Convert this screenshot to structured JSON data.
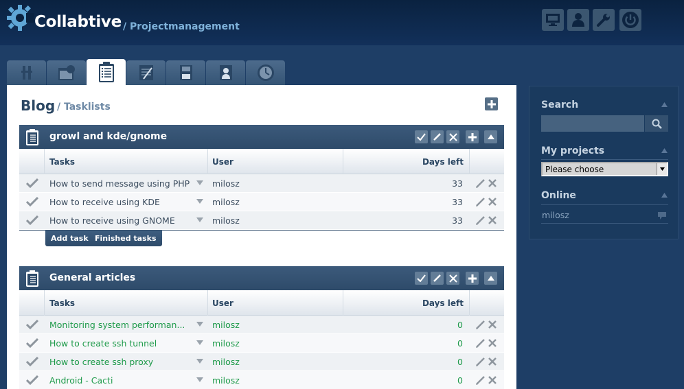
{
  "header": {
    "app_name": "Collabtive",
    "subtitle": "/ Projectmanagement",
    "buttons": [
      {
        "icon": "desktop-icon"
      },
      {
        "icon": "user-icon"
      },
      {
        "icon": "wrench-icon"
      },
      {
        "icon": "power-icon"
      }
    ]
  },
  "tabs": [
    {
      "icon": "tools-icon",
      "active": false
    },
    {
      "icon": "calendar-icon",
      "active": false
    },
    {
      "icon": "clipboard-icon",
      "active": true
    },
    {
      "icon": "notepad-icon",
      "active": false
    },
    {
      "icon": "save-icon",
      "active": false
    },
    {
      "icon": "badge-icon",
      "active": false
    },
    {
      "icon": "clock-icon",
      "active": false
    }
  ],
  "page": {
    "title": "Blog",
    "crumb": "/ Tasklists"
  },
  "columns": {
    "tasks": "Tasks",
    "user": "User",
    "days": "Days left"
  },
  "tasklists": [
    {
      "title": "growl and kde/gnome",
      "rows": [
        {
          "task": "How to send message using PHP",
          "user": "milosz",
          "days": "33"
        },
        {
          "task": "How to receive using KDE",
          "user": "milosz",
          "days": "33"
        },
        {
          "task": "How to receive using GNOME",
          "user": "milosz",
          "days": "33"
        }
      ],
      "buttons": {
        "add": "Add task",
        "finished": "Finished tasks"
      }
    },
    {
      "title": "General articles",
      "rows": [
        {
          "task": "Monitoring system performan...",
          "user": "milosz",
          "days": "0"
        },
        {
          "task": "How to create ssh tunnel",
          "user": "milosz",
          "days": "0"
        },
        {
          "task": "How to create ssh proxy",
          "user": "milosz",
          "days": "0"
        },
        {
          "task": "Android - Cacti",
          "user": "milosz",
          "days": "0"
        }
      ]
    }
  ],
  "sidebar": {
    "search_label": "Search",
    "projects_label": "My projects",
    "projects_selected": "Please choose",
    "online_label": "Online",
    "online_users": [
      "milosz"
    ]
  },
  "colors": {
    "header_bg": "#0a2240",
    "body_bg": "#1e3e66",
    "accent_green": "#1e9a4a",
    "title_blue": "#2b4763"
  }
}
